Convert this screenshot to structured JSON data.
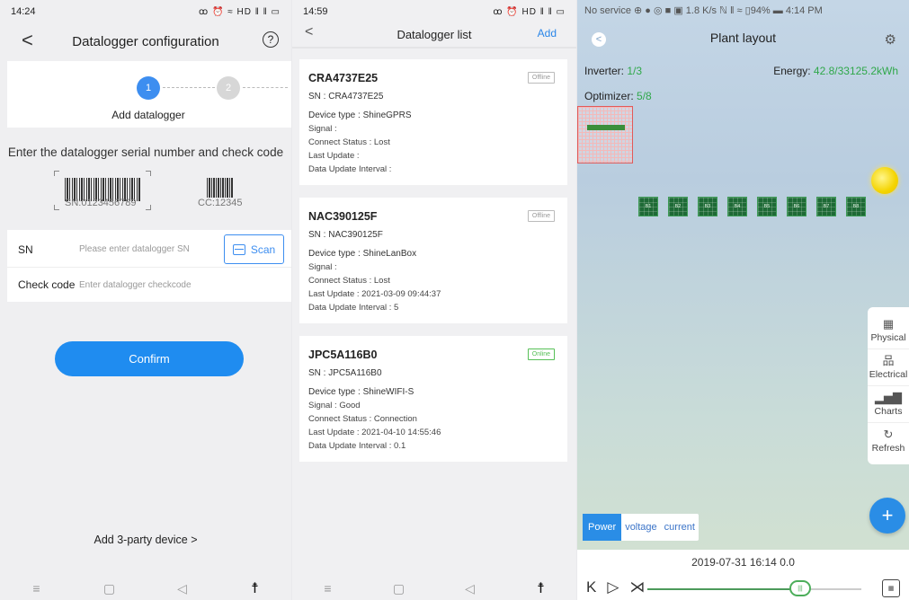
{
  "panel1": {
    "status": {
      "time": "14:24",
      "icons": "ꝏ ⏰ ≈ HD ‖ ‖ ▭"
    },
    "title": "Datalogger configuration",
    "help": "?",
    "back": "<",
    "steps": [
      "1",
      "2"
    ],
    "step_label": "Add datalogger",
    "instruction": "Enter the datalogger serial number and check code",
    "barcode_sn": "SN:0123456789",
    "barcode_cc": "CC:12345",
    "sn_label": "SN",
    "sn_placeholder": "Please enter datalogger SN",
    "scan_label": "Scan",
    "check_label": "Check code",
    "check_placeholder": "Enter datalogger checkcode",
    "confirm_label": "Confirm",
    "third_party": "Add 3-party device  >"
  },
  "panel2": {
    "status": {
      "time": "14:59",
      "icons": "ꝏ ⏰ HD ‖ ‖ ▭"
    },
    "title": "Datalogger list",
    "back": "<",
    "add_label": "Add",
    "cards": [
      {
        "name": "CRA4737E25",
        "sn": "SN : CRA4737E25",
        "status": "Offline",
        "device_type": "Device type : ShineGPRS",
        "signal": "Signal :",
        "connect": "Connect Status : Lost",
        "last_update": "Last Update :",
        "interval": "Data Update Interval :"
      },
      {
        "name": "NAC390125F",
        "sn": "SN : NAC390125F",
        "status": "Offline",
        "device_type": "Device type : ShineLanBox",
        "signal": "Signal :",
        "connect": "Connect Status : Lost",
        "last_update": "Last Update : 2021-03-09 09:44:37",
        "interval": "Data Update Interval : 5"
      },
      {
        "name": "JPC5A116B0",
        "sn": "SN : JPC5A116B0",
        "status": "Online",
        "device_type": "Device type : ShineWIFI-S",
        "signal": "Signal : Good",
        "connect": "Connect Status : Connection",
        "last_update": "Last Update : 2021-04-10 14:55:46",
        "interval": "Data Update Interval : 0.1"
      }
    ]
  },
  "panel3": {
    "status": "No service ⊕ ● ◎ ■ ▣     1.8 K/s ℕ ‖ ≈ ▯94% ▬ 4:14 PM",
    "title": "Plant layout",
    "inverter_label": "Inverter: ",
    "inverter_value": "1/3",
    "energy_label": "Energy: ",
    "energy_value": "42.8/33125.2kWh",
    "optimizer_label": "Optimizer: ",
    "optimizer_value": "5/8",
    "pv_modules": [
      "B1",
      "B2",
      "B3",
      "B4",
      "B5",
      "B6",
      "B7",
      "B8"
    ],
    "side_menu": [
      {
        "icon": "grid-icon",
        "glyph": "▦",
        "label": "Physical"
      },
      {
        "icon": "network-icon",
        "glyph": "品",
        "label": "Electrical"
      },
      {
        "icon": "bar-chart-icon",
        "glyph": "▂▅▇",
        "label": "Charts"
      },
      {
        "icon": "refresh-icon",
        "glyph": "↻",
        "label": "Refresh"
      }
    ],
    "fab": "+",
    "tabs": [
      "Power",
      "voltage",
      "current"
    ],
    "active_tab": "Power",
    "timestamp": "2019-07-31 16:14  0.0",
    "playback": {
      "first": "K",
      "play": "▷",
      "last": "⋊"
    },
    "slider_thumb": "|||",
    "playback_progress": 0.7
  }
}
